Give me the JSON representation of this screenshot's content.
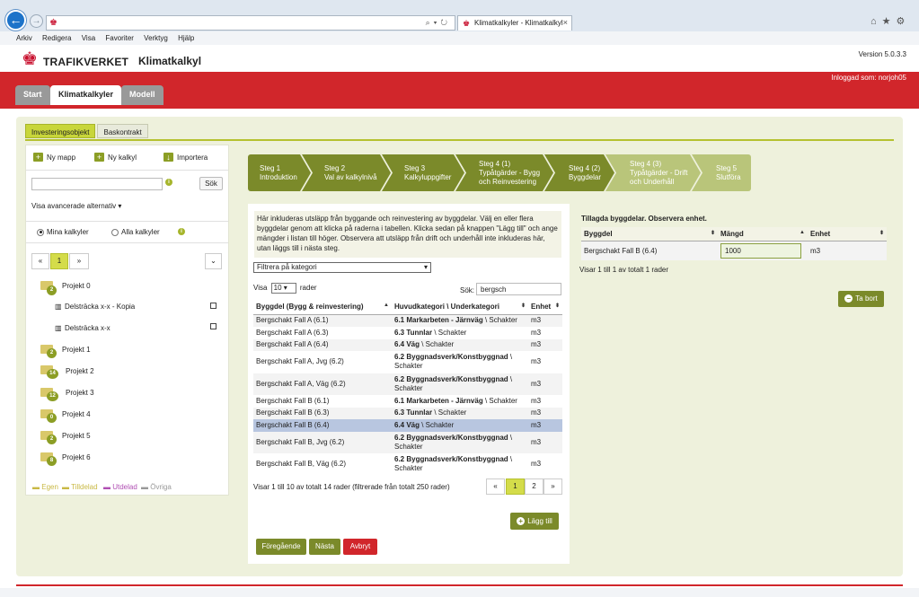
{
  "browser": {
    "tab_title": "Klimatkalkyler - Klimatkalkyl",
    "menu": [
      "Arkiv",
      "Redigera",
      "Visa",
      "Favoriter",
      "Verktyg",
      "Hjälp"
    ]
  },
  "app": {
    "brand": "TRAFIKVERKET",
    "name": "Klimatkalkyl",
    "version": "Version 5.0.3.3",
    "logged_in": "Inloggad som: norjoh05",
    "accent_color": "#d1262b",
    "green_color": "#7b8a2a"
  },
  "nav": {
    "start": "Start",
    "klimatkalkyler": "Klimatkalkyler",
    "modell": "Modell"
  },
  "subtabs": {
    "investering": "Investeringsobjekt",
    "baskontrakt": "Baskontrakt"
  },
  "left": {
    "ny_mapp": "Ny mapp",
    "ny_kalkyl": "Ny kalkyl",
    "importera": "Importera",
    "search_value": "",
    "search_btn": "Sök",
    "advanced": "Visa avancerade alternativ",
    "radio_mina": "Mina kalkyler",
    "radio_alla": "Alla kalkyler",
    "pager_prev": "«",
    "pager_page": "1",
    "pager_next": "»",
    "pager_menu": "⌄",
    "tree": {
      "p0": {
        "badge": "2",
        "label": "Projekt 0"
      },
      "d1": "Delsträcka x-x - Kopia",
      "d2": "Delsträcka x-x",
      "p1": {
        "badge": "2",
        "label": "Projekt 1"
      },
      "p2": {
        "badge": "14",
        "label": "Projekt 2"
      },
      "p3": {
        "badge": "12",
        "label": "Projekt 3"
      },
      "p4": {
        "badge": "0",
        "label": "Projekt 4"
      },
      "p5": {
        "badge": "2",
        "label": "Projekt 5"
      },
      "p6": {
        "badge": "8",
        "label": "Projekt 6"
      }
    },
    "legend": {
      "egen": "Egen",
      "tilldelad": "Tilldelad",
      "utdelad": "Utdelad",
      "ovriga": "Övriga"
    }
  },
  "steps": {
    "s1": "Steg 1\nIntroduktion",
    "s2": "Steg 2\nVal av kalkylnivå",
    "s3": "Steg 3\nKalkyluppgifter",
    "s4": "Steg 4 (1)\nTypåtgärder - Bygg och Reinvestering",
    "s5": "Steg 4 (2)\nByggdelar",
    "s6": "Steg 4 (3)\nTypåtgärder - Drift och Underhåll",
    "s7": "Steg 5\nSlutföra"
  },
  "center": {
    "info": "Här inkluderas utsläpp från byggande och reinvestering av byggdelar. Välj en eller flera byggdelar genom att klicka på raderna i tabellen. Klicka sedan på knappen \"Lägg till\" och ange mängder i listan till höger. Observera att utsläpp från drift och underhåll inte inkluderas här, utan läggs till i nästa steg.",
    "filter": "Filtrera på kategori",
    "visa": "Visa",
    "visa_value": "10",
    "rader": "rader",
    "sok_label": "Sök:",
    "sok_value": "bergsch",
    "headers": [
      "Byggdel (Bygg & reinvestering)",
      "Huvudkategori \\ Underkategori",
      "Enhet"
    ],
    "rows": {
      "r0": {
        "byggdel": "Bergschakt Fall A (6.1)",
        "kat_bold": "6.1 Markarbeten - Järnväg",
        "kat_sub": " \\ Schakter",
        "enhet": "m3"
      },
      "r1": {
        "byggdel": "Bergschakt Fall A (6.3)",
        "kat_bold": "6.3 Tunnlar",
        "kat_sub": " \\ Schakter",
        "enhet": "m3"
      },
      "r2": {
        "byggdel": "Bergschakt Fall A (6.4)",
        "kat_bold": "6.4 Väg",
        "kat_sub": " \\ Schakter",
        "enhet": "m3"
      },
      "r3": {
        "byggdel": "Bergschakt Fall A, Jvg (6.2)",
        "kat_bold": "6.2 Byggnadsverk/Konstbyggnad",
        "kat_sub": " \\ Schakter",
        "enhet": "m3"
      },
      "r4": {
        "byggdel": "Bergschakt Fall A, Väg (6.2)",
        "kat_bold": "6.2 Byggnadsverk/Konstbyggnad",
        "kat_sub": " \\ Schakter",
        "enhet": "m3"
      },
      "r5": {
        "byggdel": "Bergschakt Fall B (6.1)",
        "kat_bold": "6.1 Markarbeten - Järnväg",
        "kat_sub": " \\ Schakter",
        "enhet": "m3"
      },
      "r6": {
        "byggdel": "Bergschakt Fall B (6.3)",
        "kat_bold": "6.3 Tunnlar",
        "kat_sub": " \\ Schakter",
        "enhet": "m3"
      },
      "r7": {
        "byggdel": "Bergschakt Fall B (6.4)",
        "kat_bold": "6.4 Väg",
        "kat_sub": " \\ Schakter",
        "enhet": "m3"
      },
      "r8": {
        "byggdel": "Bergschakt Fall B, Jvg (6.2)",
        "kat_bold": "6.2 Byggnadsverk/Konstbyggnad",
        "kat_sub": " \\ Schakter",
        "enhet": "m3"
      },
      "r9": {
        "byggdel": "Bergschakt Fall B, Väg (6.2)",
        "kat_bold": "6.2 Byggnadsverk/Konstbyggnad",
        "kat_sub": " \\ Schakter",
        "enhet": "m3"
      }
    },
    "footer": "Visar 1 till 10 av totalt 14 rader (filtrerade från totalt 250 rader)",
    "pager": {
      "prev": "«",
      "p1": "1",
      "p2": "2",
      "next": "»"
    },
    "lagg_till": "Lägg till",
    "foregaende": "Föregående",
    "nasta": "Nästa",
    "avbryt": "Avbryt"
  },
  "right": {
    "title": "Tillagda byggdelar. Observera enhet.",
    "headers": [
      "Byggdel",
      "Mängd",
      "Enhet"
    ],
    "row": {
      "byggdel": "Bergschakt Fall B (6.4)",
      "mangd": "1000",
      "enhet": "m3"
    },
    "footer": "Visar 1 till 1 av totalt 1 rader",
    "ta_bort": "Ta bort"
  }
}
